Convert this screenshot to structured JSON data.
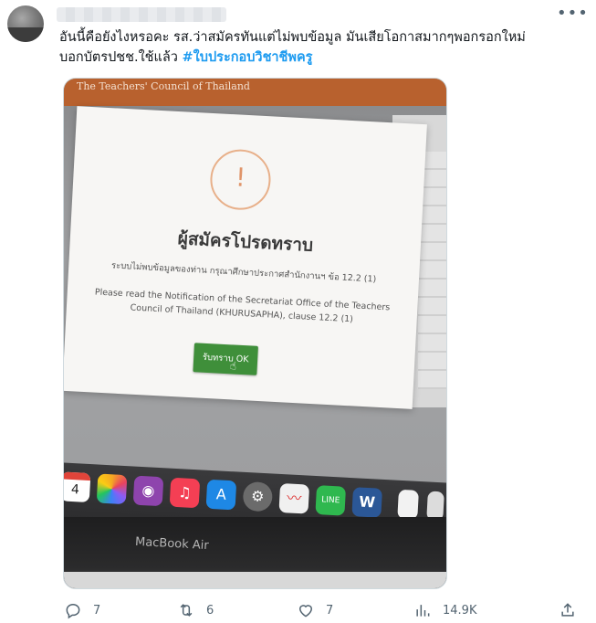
{
  "author": {
    "avatar_icon": "avatar-blurred",
    "more_icon": "more-options-icon",
    "more_glyph": "•••"
  },
  "tweet": {
    "text_line1": "อันนี้คือยังไงหรอคะ รส.ว่าสมัครทันแต่ไม่พบข้อมูล มันเสียโอกาสมากๆพอกรอกใหม่",
    "text_line2": "บอกบัตรปชช.ใช้แล้ว",
    "hashtag": "#ใบประกอบวิชาชีพครู"
  },
  "photo": {
    "site_title": "The Teachers' Council of Thailand",
    "dialog": {
      "alert_mark": "!",
      "title": "ผู้สมัครโปรดทราบ",
      "thai_message": "ระบบไม่พบข้อมูลของท่าน กรุณาศึกษาประกาศสำนักงานฯ ข้อ 12.2 (1)",
      "english_message": "Please read the Notification of the Secretariat Office of the Teachers Council of Thailand (KHURUSAPHA), clause 12.2 (1)",
      "button_label": "รับทราบ OK"
    },
    "dock": {
      "calendar_day": "4",
      "line_label": "LINE",
      "word_label": "W"
    },
    "laptop_label": "MacBook Air"
  },
  "actions": {
    "reply_count": "7",
    "retweet_count": "6",
    "like_count": "7",
    "views_count": "14.9K"
  },
  "colors": {
    "hashtag": "#1d9bf0",
    "icon_grey": "#536471",
    "ok_button": "#3f8f3a"
  }
}
